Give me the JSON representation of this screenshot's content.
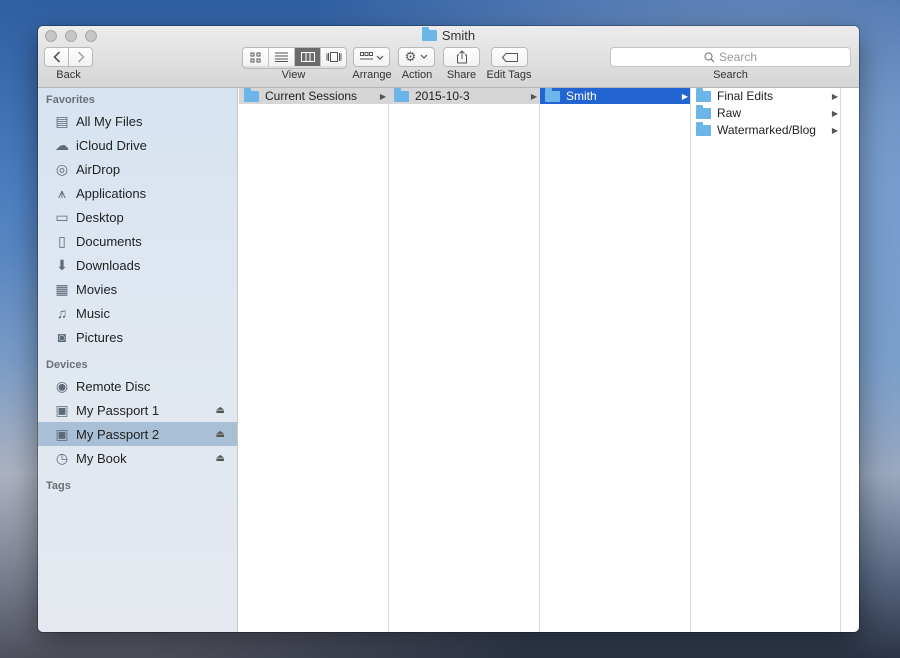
{
  "window": {
    "title": "Smith"
  },
  "toolbar": {
    "back_label": "Back",
    "view_label": "View",
    "arrange_label": "Arrange",
    "action_label": "Action",
    "share_label": "Share",
    "edit_tags_label": "Edit Tags",
    "search_placeholder": "Search",
    "search_label": "Search",
    "active_view": "columns"
  },
  "sidebar": {
    "favorites_title": "Favorites",
    "favorites": [
      {
        "label": "All My Files",
        "icon": "all-files-icon"
      },
      {
        "label": "iCloud Drive",
        "icon": "cloud-icon"
      },
      {
        "label": "AirDrop",
        "icon": "airdrop-icon"
      },
      {
        "label": "Applications",
        "icon": "applications-icon"
      },
      {
        "label": "Desktop",
        "icon": "desktop-icon"
      },
      {
        "label": "Documents",
        "icon": "documents-icon"
      },
      {
        "label": "Downloads",
        "icon": "downloads-icon"
      },
      {
        "label": "Movies",
        "icon": "movies-icon"
      },
      {
        "label": "Music",
        "icon": "music-icon"
      },
      {
        "label": "Pictures",
        "icon": "pictures-icon"
      }
    ],
    "devices_title": "Devices",
    "devices": [
      {
        "label": "Remote Disc",
        "icon": "disc-icon",
        "eject": false
      },
      {
        "label": "My Passport 1",
        "icon": "drive-icon",
        "eject": true
      },
      {
        "label": "My Passport 2",
        "icon": "drive-icon",
        "eject": true,
        "selected": true
      },
      {
        "label": "My Book",
        "icon": "time-machine-drive-icon",
        "eject": true
      }
    ],
    "tags_title": "Tags"
  },
  "columns": [
    {
      "items": [
        "Current Sessions"
      ]
    },
    {
      "items": [
        "2015-10-3"
      ]
    },
    {
      "items": [
        "Smith"
      ]
    },
    {
      "items": [
        "Final Edits",
        "Raw",
        "Watermarked/Blog"
      ]
    }
  ],
  "colors": {
    "selection_active": "#2164d2",
    "selection_path": "#d6d6d6",
    "sidebar_selected": "#a9bfd6",
    "folder": "#6cb5e9"
  }
}
